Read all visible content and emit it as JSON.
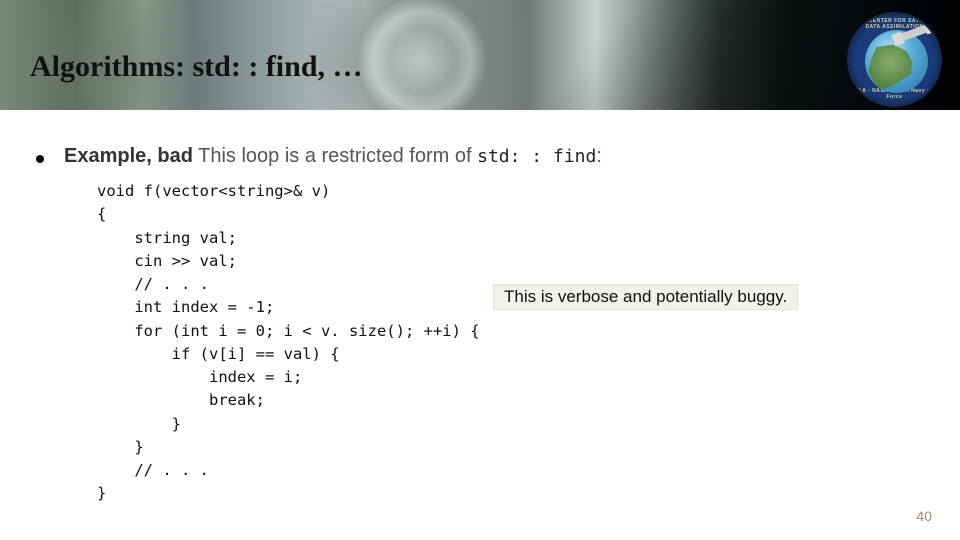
{
  "slide": {
    "title": "Algorithms: std: : find, …",
    "page_number": "40"
  },
  "logo": {
    "ring_top": "JOINT CENTER FOR SATELLITE DATA ASSIMILATION",
    "ring_bottom": "NOAA · NASA   JCSDA   Navy · Air Force"
  },
  "example": {
    "label": "Example, bad",
    "description": " This loop is a restricted form of ",
    "mono_ref": "std: : find",
    "colon": ":"
  },
  "code": {
    "lines": [
      "void f(vector<string>& v)",
      "{",
      "    string val;",
      "    cin >> val;",
      "    // . . .",
      "    int index = -1;",
      "    for (int i = 0; i < v. size(); ++i) {",
      "        if (v[i] == val) {",
      "            index = i;",
      "            break;",
      "        }",
      "    }",
      "    // . . .",
      "}"
    ]
  },
  "annotation": {
    "text": "This is verbose and potentially buggy."
  }
}
